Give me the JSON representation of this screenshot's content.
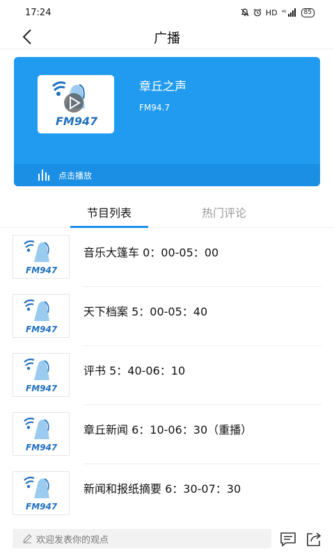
{
  "status_bar": {
    "time": "17:24",
    "network": "HD",
    "battery": "85"
  },
  "header": {
    "title": "广播"
  },
  "player": {
    "station_name": "章丘之声",
    "frequency": "FM94.7",
    "play_label": "点击播放",
    "logo_text": "FM947",
    "accent_color": "#219bf0"
  },
  "tabs": [
    {
      "label": "节目列表",
      "active": true
    },
    {
      "label": "热门评论",
      "active": false
    }
  ],
  "programs": [
    {
      "title": "音乐大篷车 0：00-05：00",
      "logo_text": "FM947"
    },
    {
      "title": "天下档案 5：00-05：40",
      "logo_text": "FM947"
    },
    {
      "title": "评书 5：40-06：10",
      "logo_text": "FM947"
    },
    {
      "title": "章丘新闻 6：10-06：30（重播）",
      "logo_text": "FM947"
    },
    {
      "title": "新闻和报纸摘要 6：30-07：30",
      "logo_text": "FM947"
    }
  ],
  "bottom_bar": {
    "comment_placeholder": "欢迎发表你的观点"
  }
}
